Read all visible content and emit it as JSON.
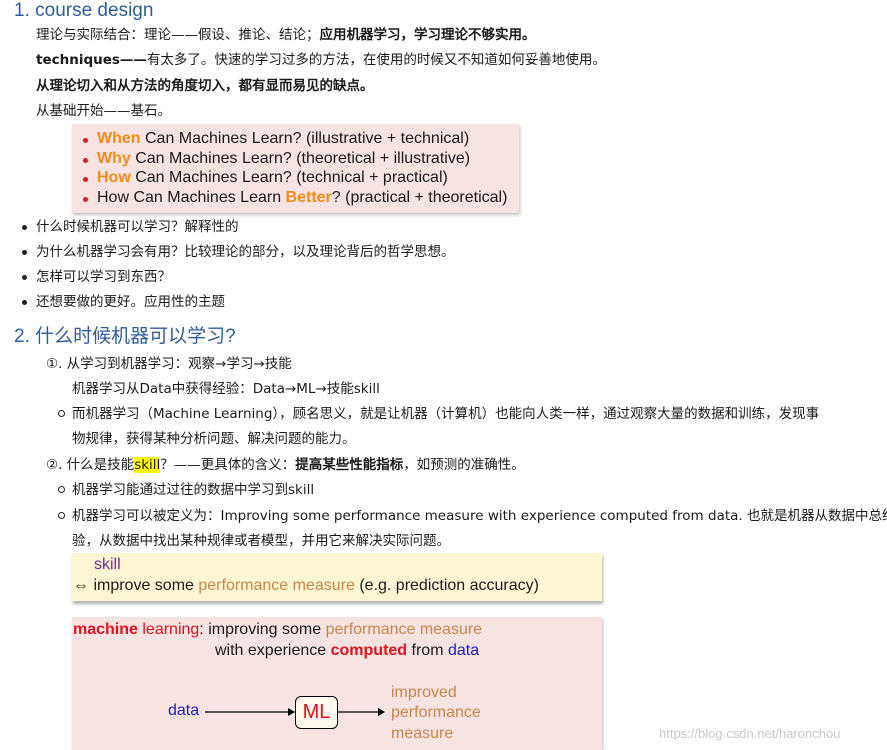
{
  "section1": {
    "heading": "1. course design",
    "line1_plain": "理论与实际结合：理论——假设、推论、结论；",
    "line1_bold": "应用机器学习，学习理论不够实用。",
    "line2_bold": "techniques——",
    "line2_plain": "有太多了。快速的学习过多的方法，在使用的时候又不知道如何妥善地使用。",
    "line3_bold": "从理论切入和从方法的角度切入，都有显而易见的缺点。",
    "line4": "从基础开始——基石。",
    "slide": {
      "items": [
        {
          "key": "When",
          "rest": " Can Machines Learn? (illustrative + technical)"
        },
        {
          "key": "Why",
          "rest": " Can Machines Learn? (theoretical + illustrative)"
        },
        {
          "key": "How",
          "rest": " Can Machines Learn? (technical + practical)"
        },
        {
          "pre": "How Can Machines Learn ",
          "key": "Better",
          "rest": "? (practical + theoretical)"
        }
      ]
    },
    "bullets": [
      "什么时候机器可以学习？解释性的",
      "为什么机器学习会有用？比较理论的部分，以及理论背后的哲学思想。",
      "怎样可以学习到东西？",
      "还想要做的更好。应用性的主题"
    ]
  },
  "section2": {
    "heading": "2. 什么时候机器可以学习?",
    "item1_line1": "①. 从学习到机器学习：观察→学习→技能",
    "item1_line2": "机器学习从Data中获得经验：Data→ML→技能skill",
    "sub1_line1": "而机器学习（Machine Learning），顾名思义，就是让机器（计算机）也能向人类一样，通过观察大量的数据和训练，发现事",
    "sub1_line2": "物规律，获得某种分析问题、解决问题的能力。",
    "item2_pre": "②. 什么是技能",
    "item2_hl": "skill",
    "item2_mid": "？——更具体的含义：",
    "item2_bold": "提高某些性能指标",
    "item2_post": "，如预测的准确性。",
    "sub2": "机器学习能通过过往的数据中学习到skill",
    "sub3_line1": "机器学习可以被定义为：Improving some performance measure with experience computed from data. 也就是机器从数据中总结经",
    "sub3_line2": "验，从数据中找出某种规律或者模型，并用它来解决实际问题。",
    "skillbox": {
      "word": "skill",
      "arrow": "⇔",
      "pre": " improve some ",
      "pm": "performance measure",
      "post": " (e.g. prediction accuracy)"
    },
    "mlbox": {
      "ml_red": "machine",
      "ml_tan": " learning",
      "colon": ": improving some ",
      "pm": "performance measure",
      "line2_pre": "with experience ",
      "computed": "computed",
      "from": " from ",
      "data": "data",
      "diagram_data": "data",
      "diagram_ml": "ML",
      "out1": "improved",
      "out2": "performance",
      "out3": "measure"
    }
  },
  "watermark": "https://blog.csdn.net/haronchou",
  "colors": {
    "heading_blue": "#2f5e9e",
    "accent_orange": "#f28b17",
    "box_pink": "#f8e3e3",
    "box_yellow": "#fdf6d3",
    "highlight": "#ffff00"
  }
}
